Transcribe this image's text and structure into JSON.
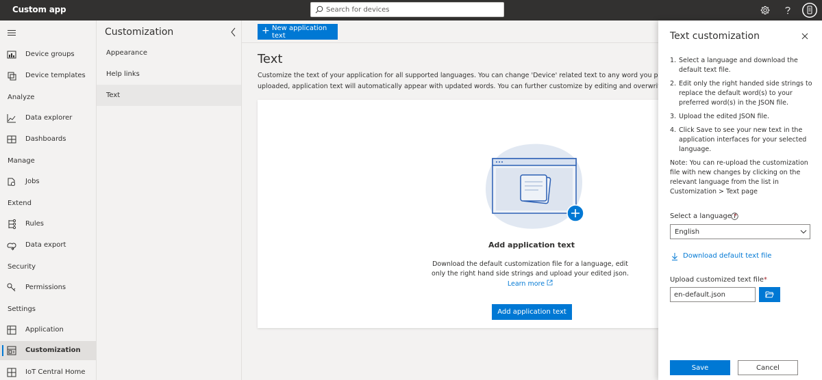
{
  "topbar": {
    "app_title": "Custom app",
    "search_placeholder": "Search for devices",
    "icons": [
      "gear-icon",
      "help-icon",
      "user-avatar-icon"
    ]
  },
  "nav": {
    "items": [
      {
        "label": "Device groups",
        "icon": "chart-icon"
      },
      {
        "label": "Device templates",
        "icon": "template-icon"
      },
      {
        "section": "Analyze"
      },
      {
        "label": "Data explorer",
        "icon": "line-chart-icon"
      },
      {
        "label": "Dashboards",
        "icon": "dashboard-icon"
      },
      {
        "section": "Manage"
      },
      {
        "label": "Jobs",
        "icon": "jobs-icon"
      },
      {
        "section": "Extend"
      },
      {
        "label": "Rules",
        "icon": "rules-icon"
      },
      {
        "label": "Data export",
        "icon": "export-icon"
      },
      {
        "section": "Security"
      },
      {
        "label": "Permissions",
        "icon": "key-icon"
      },
      {
        "section": "Settings"
      },
      {
        "label": "Application",
        "icon": "application-icon"
      },
      {
        "label": "Customization",
        "icon": "customization-icon",
        "active": true
      },
      {
        "label": "IoT Central Home",
        "icon": "home-grid-icon"
      }
    ]
  },
  "subnav": {
    "title": "Customization",
    "items": [
      "Appearance",
      "Help links",
      "Text"
    ],
    "active": "Text"
  },
  "command_bar": {
    "new_button": "New application text"
  },
  "main": {
    "title": "Text",
    "description_line1": "Customize the text of your application for all supported languages. You can change 'Device' related text to any word you prefer using th",
    "description_line2": "uploaded, application text will automatically appear with updated words. You can further customize by editing and overwriting the custo",
    "card": {
      "heading": "Add application text",
      "text": "Download the default customization file for a language, edit only the right hand side strings and upload your edited json.",
      "learn_more": "Learn more",
      "button": "Add application text"
    }
  },
  "panel": {
    "title": "Text customization",
    "steps": [
      "Select a language and download the default text file.",
      "Edit only the right handed side strings to replace the default word(s) to your preferred word(s) in the JSON file.",
      "Upload the edited JSON file.",
      "Click Save to see your new text in the application interfaces for your selected language."
    ],
    "note": "Note: You can re-upload the customization file with new changes by clicking on the relevant language from the list in Customization > Text page",
    "language_label": "Select a language",
    "language_value": "English",
    "download_link": "Download default text file",
    "upload_label": "Upload customized text file",
    "upload_value": "en-default.json",
    "save_button": "Save",
    "cancel_button": "Cancel"
  },
  "colors": {
    "accent": "#0078d4",
    "topbar": "#323130",
    "required": "#a4262c"
  }
}
